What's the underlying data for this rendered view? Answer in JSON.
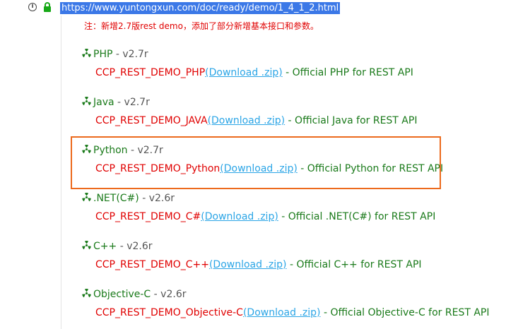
{
  "browser": {
    "url": "https://www.yuntongxun.com/doc/ready/demo/1_4_1_2.html"
  },
  "notice": "注：新增2.7版rest demo，添加了部分新增基本接口和参数。",
  "demos": [
    {
      "lang": "PHP",
      "version": " - v2.7r",
      "package": "CCP_REST_DEMO_PHP",
      "download": "(Download .zip)",
      "description": " - Official PHP for REST API"
    },
    {
      "lang": "Java",
      "version": " - v2.7r",
      "package": "CCP_REST_DEMO_JAVA",
      "download": "(Download .zip)",
      "description": " - Official Java for REST API"
    },
    {
      "lang": "Python",
      "version": " - v2.7r",
      "package": "CCP_REST_DEMO_Python",
      "download": "(Download .zip)",
      "description": " - Official Python for REST API"
    },
    {
      "lang": ".NET(C#)",
      "version": " - v2.6r",
      "package": "CCP_REST_DEMO_C#",
      "download": "(Download .zip)",
      "description": " - Official .NET(C#) for REST API"
    },
    {
      "lang": "C++",
      "version": " - v2.6r",
      "package": "CCP_REST_DEMO_C++",
      "download": "(Download .zip)",
      "description": " - Official C++ for REST API"
    },
    {
      "lang": "Objective-C",
      "version": " - v2.6r",
      "package": "CCP_REST_DEMO_Objective-C",
      "download": "(Download .zip)",
      "description": " - Official Objective-C for REST API"
    }
  ],
  "colors": {
    "highlight_border": "#ec6a1d",
    "package_red": "#e00000",
    "link_blue": "#2ba5e6",
    "text_green": "#1a7a1a",
    "url_selection": "#3b78e7"
  }
}
